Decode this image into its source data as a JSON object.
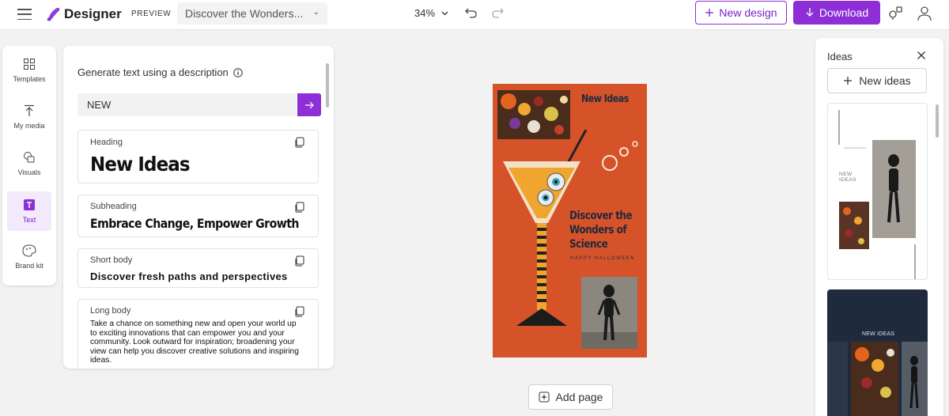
{
  "app": {
    "name": "Designer",
    "badge": "PREVIEW",
    "doc_title": "Discover the Wonders...",
    "zoom": "34%"
  },
  "toolbar": {
    "new_design_label": "New design",
    "download_label": "Download"
  },
  "rail": {
    "items": [
      {
        "label": "Templates",
        "icon": "templates-icon"
      },
      {
        "label": "My media",
        "icon": "upload-icon"
      },
      {
        "label": "Visuals",
        "icon": "visuals-icon"
      },
      {
        "label": "Text",
        "icon": "text-icon",
        "active": true
      },
      {
        "label": "Brand kit",
        "icon": "palette-icon"
      }
    ]
  },
  "text_panel": {
    "title": "Generate text using a description",
    "prompt_value": "NEW",
    "cards": [
      {
        "caption": "Heading",
        "value": "New Ideas"
      },
      {
        "caption": "Subheading",
        "value": "Embrace Change, Empower Growth"
      },
      {
        "caption": "Short body",
        "value": "Discover fresh paths and perspectives"
      },
      {
        "caption": "Long body",
        "value": "Take a chance on something new and open your world up to exciting innovations that can empower you and your community. Look outward for inspiration; broadening your view can help you discover creative solutions and inspiring ideas."
      }
    ]
  },
  "canvas": {
    "heading": "New Ideas",
    "title": "Discover the Wonders of Science",
    "tagline": "HAPPY HALLOWEEN",
    "add_page_label": "Add page"
  },
  "ideas_panel": {
    "title": "Ideas",
    "new_ideas_label": "New ideas",
    "thumbs": [
      {
        "label": "NEW IDEAS"
      },
      {
        "label": "NEW IDEAS"
      }
    ]
  },
  "colors": {
    "accent": "#8d2ed6",
    "artboard_bg": "#d6532a",
    "art_text": "#1f2a3d"
  }
}
